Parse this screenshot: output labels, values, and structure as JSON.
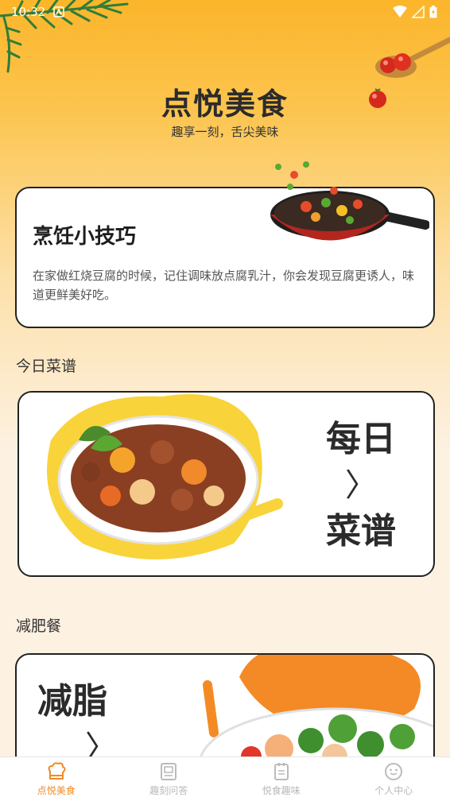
{
  "status_bar": {
    "time": "10:32"
  },
  "header": {
    "title": "点悦美食",
    "subtitle": "趣享一刻，舌尖美味"
  },
  "tip_card": {
    "title": "烹饪小技巧",
    "text": "在家做红烧豆腐的时候，记住调味放点腐乳汁，你会发现豆腐更诱人，味道更鲜美好吃。"
  },
  "today_section": {
    "label": "今日菜谱",
    "card_line1": "每日",
    "card_arrow": "〉",
    "card_line2": "菜谱"
  },
  "diet_section": {
    "label": "减肥餐",
    "card_line1": "减脂",
    "card_arrow": "〉"
  },
  "bottom_nav": {
    "items": [
      {
        "label": "点悦美食",
        "icon": "chef-hat-icon",
        "active": true
      },
      {
        "label": "趣刻问答",
        "icon": "book-icon",
        "active": false
      },
      {
        "label": "悦食趣味",
        "icon": "note-icon",
        "active": false
      },
      {
        "label": "个人中心",
        "icon": "smile-icon",
        "active": false
      }
    ]
  },
  "colors": {
    "accent": "#f08a24",
    "header_bg": "#fbb52a",
    "card_border": "#222222"
  }
}
